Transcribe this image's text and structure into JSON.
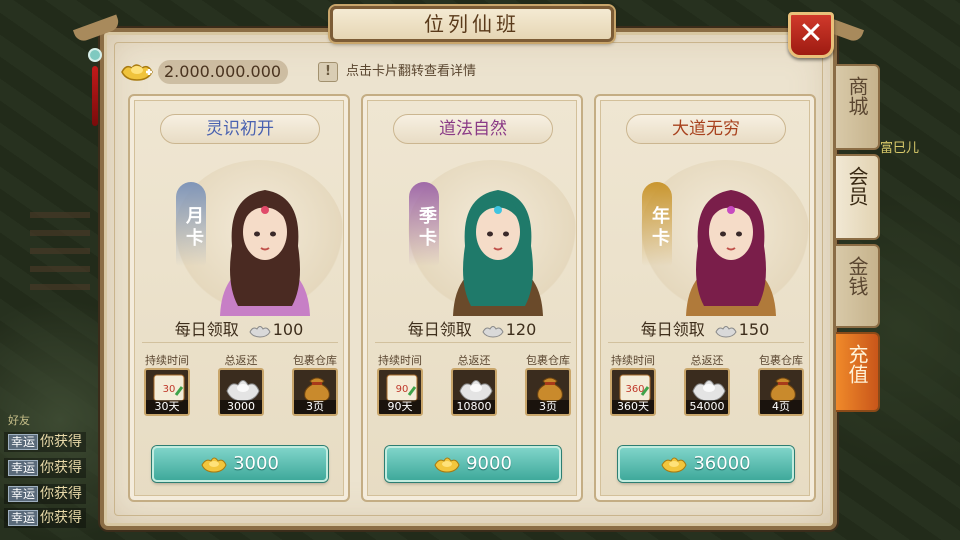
{
  "window": {
    "title": "位列仙班",
    "close_icon": "✕"
  },
  "header": {
    "gold_amount": "2.000.000.000",
    "tip_text": "点击卡片翻转查看详情",
    "tip_icon": "!"
  },
  "tabs": [
    {
      "label": "商城",
      "active": false
    },
    {
      "label": "会员",
      "active": true
    },
    {
      "label": "金钱",
      "active": false
    },
    {
      "label": "充值",
      "active": false
    }
  ],
  "stat_labels": {
    "duration": "持续时间",
    "total_return": "总返还",
    "bag_storage": "包裹仓库"
  },
  "daily_label": "每日领取",
  "cards": [
    {
      "title": "灵识初开",
      "title_color": "#4a62b0",
      "ribbon": "月卡",
      "ribbon_color": "#7f95b8",
      "daily_amount": "100",
      "duration_icon_text": "30",
      "duration": "30天",
      "total_return": "3000",
      "bag_storage": "3页",
      "price": "3000"
    },
    {
      "title": "道法自然",
      "title_color": "#8a3a86",
      "ribbon": "季卡",
      "ribbon_color": "#a06aa8",
      "daily_amount": "120",
      "duration_icon_text": "90",
      "duration": "90天",
      "total_return": "10800",
      "bag_storage": "3页",
      "price": "9000"
    },
    {
      "title": "大道无穷",
      "title_color": "#a8421e",
      "ribbon": "年卡",
      "ribbon_color": "#c9962f",
      "daily_amount": "150",
      "duration_icon_text": "360",
      "duration": "360天",
      "total_return": "54000",
      "bag_storage": "4页",
      "price": "36000"
    }
  ],
  "background": {
    "chat_header": "好友",
    "chat_tag": "幸运",
    "chat_text": "你获得",
    "side_player_name": "富巳儿"
  }
}
